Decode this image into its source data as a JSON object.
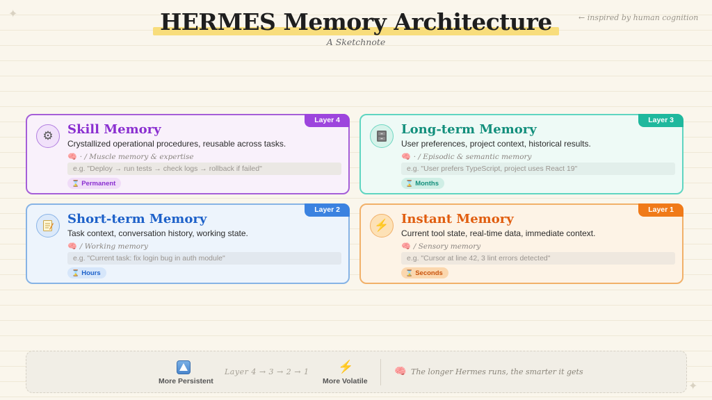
{
  "header": {
    "title": "HERMES Memory Architecture",
    "subtitle": "A Sketchnote",
    "note": "← inspired by human cognition"
  },
  "cards": {
    "skill": {
      "layer": "Layer 4",
      "title": "Skill Memory",
      "description": "Crystallized operational procedures, reusable across tasks.",
      "sub": "· / Muscle memory & expertise",
      "example": "e.g. \"Deploy → run tests → check logs → rollback if failed\"",
      "retention": "Permanent",
      "icon": "gear-icon",
      "accent": "#9d45dd"
    },
    "longterm": {
      "layer": "Layer 3",
      "title": "Long-term Memory",
      "description": "User preferences, project context, historical results.",
      "sub": "· / Episodic & semantic memory",
      "example": "e.g. \"User prefers TypeScript, project uses React 19\"",
      "retention": "Months",
      "icon": "file-cabinet-icon",
      "accent": "#1fb89d"
    },
    "shortterm": {
      "layer": "Layer 2",
      "title": "Short-term Memory",
      "description": "Task context, conversation history, working state.",
      "sub": "/ Working memory",
      "example": "e.g. \"Current task: fix login bug in auth module\"",
      "retention": "Hours",
      "icon": "memo-icon",
      "accent": "#3b82e0"
    },
    "instant": {
      "layer": "Layer 1",
      "title": "Instant Memory",
      "description": "Current tool state, real-time data, immediate context.",
      "sub": "/ Sensory memory",
      "example": "e.g. \"Cursor at line 42, 3 lint errors detected\"",
      "retention": "Seconds",
      "icon": "lightning-icon",
      "accent": "#f07a19"
    }
  },
  "legend": {
    "persistent_label": "More Persistent",
    "flow": "Layer 4 → 3 → 2 → 1",
    "volatile_label": "More Volatile",
    "tagline": "The longer Hermes runs, the smarter it gets"
  }
}
